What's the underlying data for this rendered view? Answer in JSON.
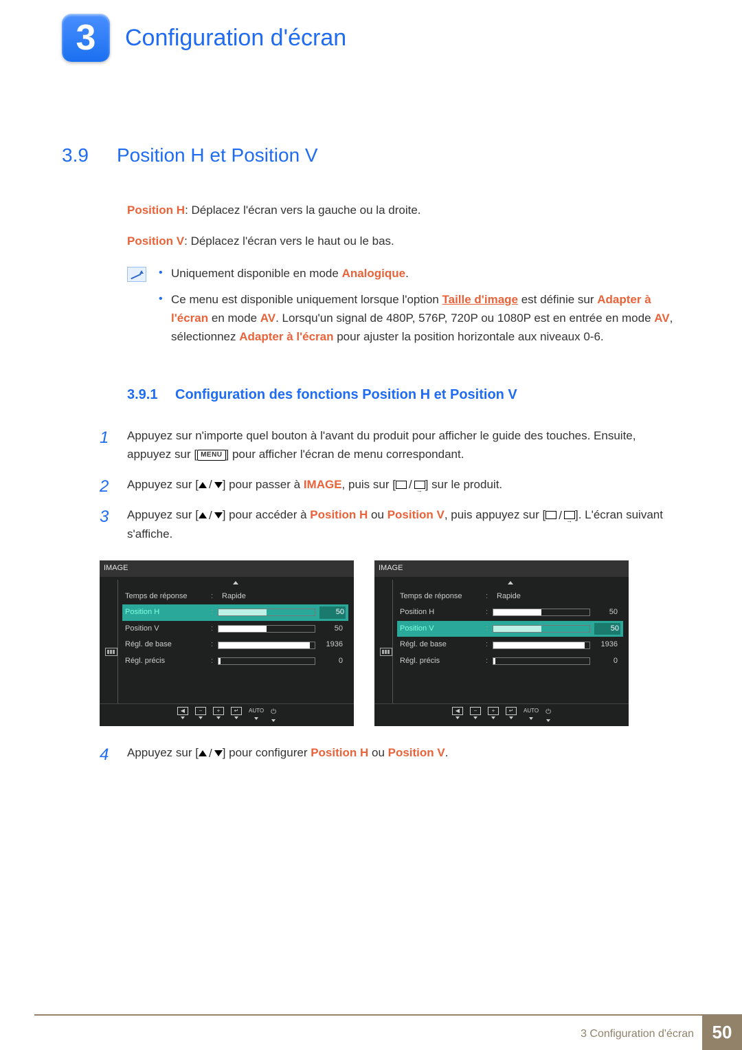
{
  "chapter": {
    "number": "3",
    "title": "Configuration d'écran"
  },
  "section": {
    "number": "3.9",
    "title": "Position H et Position V"
  },
  "intro": {
    "posH_label": "Position H",
    "posH_text": ": Déplacez l'écran vers la gauche ou la droite.",
    "posV_label": "Position V",
    "posV_text": ": Déplacez l'écran vers le haut ou le bas."
  },
  "notes": {
    "n1_pre": "Uniquement disponible en mode ",
    "n1_em": "Analogique",
    "n1_post": ".",
    "n2_a": "Ce menu est disponible uniquement lorsque l'option ",
    "n2_link": "Taille d'image",
    "n2_b": " est définie sur ",
    "n2_em1": "Adapter à l'écran",
    "n2_c": " en mode ",
    "n2_em2": "AV",
    "n2_d": ". Lorsqu'un signal de 480P, 576P, 720P ou 1080P est en entrée en mode ",
    "n2_em3": "AV",
    "n2_e": ", sélectionnez ",
    "n2_em4": "Adapter à l'écran",
    "n2_f": " pour ajuster la position horizontale aux niveaux 0-6."
  },
  "subsection": {
    "number": "3.9.1",
    "title": "Configuration des fonctions Position H et Position V"
  },
  "steps": {
    "s1a": "Appuyez sur n'importe quel bouton à l'avant du produit pour afficher le guide des touches. Ensuite, appuyez sur [",
    "s1_menu": "MENU",
    "s1b": "] pour afficher l'écran de menu correspondant.",
    "s2a": "Appuyez sur [",
    "s2b": "] pour passer à ",
    "s2_em": "IMAGE",
    "s2c": ", puis sur [",
    "s2d": "] sur le produit.",
    "s3a": "Appuyez sur [",
    "s3b": "] pour accéder à ",
    "s3_em1": "Position H",
    "s3_or": " ou ",
    "s3_em2": "Position V",
    "s3c": ", puis appuyez sur [",
    "s3d": "]. L'écran suivant s'affiche.",
    "s4a": "Appuyez sur [",
    "s4b": "] pour configurer ",
    "s4_em1": "Position H",
    "s4_or": " ou ",
    "s4_em2": "Position V",
    "s4c": "."
  },
  "osd": {
    "title": "IMAGE",
    "rows": {
      "resp": {
        "label": "Temps de réponse",
        "value": "Rapide"
      },
      "posH": {
        "label": "Position H",
        "value": "50",
        "pct": 50
      },
      "posV": {
        "label": "Position V",
        "value": "50",
        "pct": 50
      },
      "base": {
        "label": "Régl. de base",
        "value": "1936",
        "pct": 95
      },
      "fine": {
        "label": "Régl. précis",
        "value": "0",
        "pct": 2
      }
    },
    "footer": {
      "auto": "AUTO"
    }
  },
  "footer": {
    "text": "3 Configuration d'écran",
    "page": "50"
  }
}
